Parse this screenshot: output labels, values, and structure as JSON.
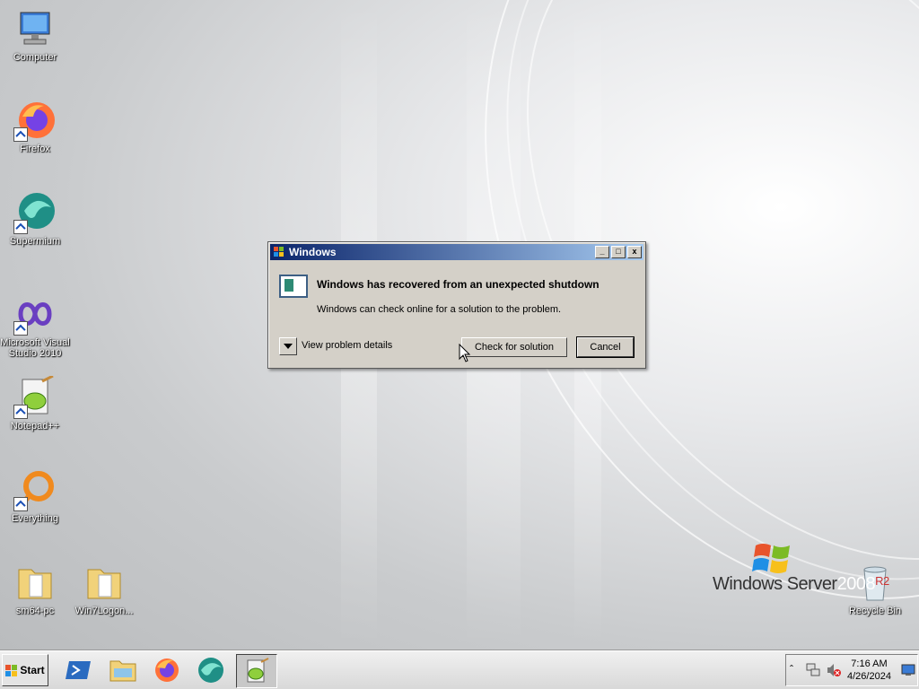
{
  "desktop": {
    "icons": [
      {
        "label": "Computer"
      },
      {
        "label": "Firefox"
      },
      {
        "label": "Supermium"
      },
      {
        "label": "Microsoft Visual Studio 2010"
      },
      {
        "label": "Notepad++"
      },
      {
        "label": "Everything"
      },
      {
        "label": "sm64-pc"
      },
      {
        "label": "Win7Logon..."
      },
      {
        "label": "Recycle Bin"
      }
    ],
    "branding": {
      "text": "Windows Server",
      "year": "2008",
      "edition": "R2"
    }
  },
  "dialog": {
    "title": "Windows",
    "heading": "Windows has recovered from an unexpected shutdown",
    "message": "Windows can check online for a solution to the problem.",
    "details_label": "View problem details",
    "check_button": "Check for solution",
    "cancel_button": "Cancel",
    "title_buttons": {
      "minimize": "_",
      "maximize": "□",
      "close": "x"
    }
  },
  "taskbar": {
    "start_label": "Start",
    "items": [
      "powershell-icon",
      "explorer-icon",
      "firefox-icon",
      "supermium-icon",
      "notepad-plus-plus-icon"
    ],
    "clock": {
      "time": "7:16 AM",
      "date": "4/26/2024"
    }
  },
  "colors": {
    "titlebar_start": "#0a246a",
    "titlebar_end": "#a6caf0",
    "dialog_bg": "#d4d0c8"
  }
}
